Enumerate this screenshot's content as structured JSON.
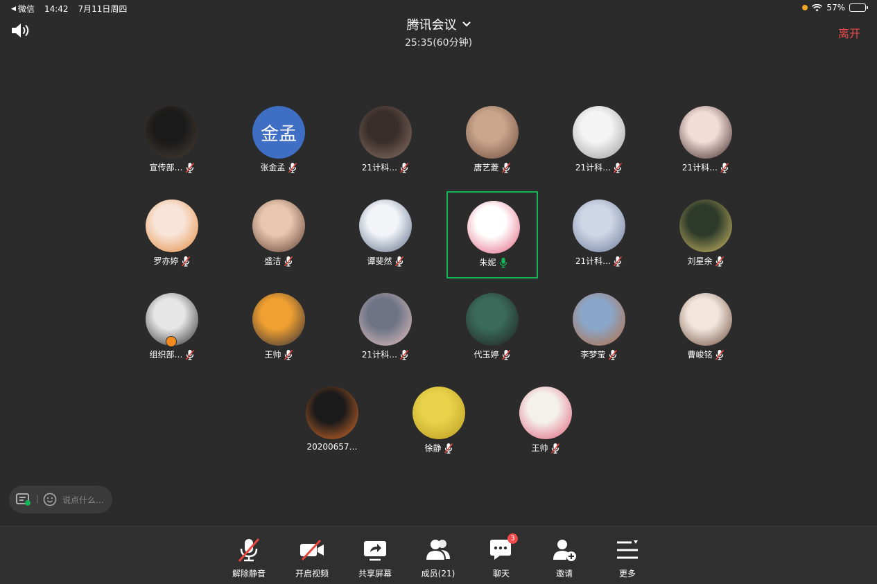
{
  "status_bar": {
    "back_app": "微信",
    "time": "14:42",
    "date": "7月11日周四",
    "battery": "57%",
    "battery_level": 0.57
  },
  "header": {
    "title": "腾讯会议",
    "timer": "25:35(60分钟)",
    "leave_label": "离开"
  },
  "participants": [
    {
      "name": "宣传部…",
      "muted": true,
      "avatar_colors": [
        "#1a1a1a",
        "#4a4038"
      ]
    },
    {
      "name": "张金孟",
      "muted": true,
      "avatar_text": "金孟",
      "avatar_colors": [
        "#3f6fc4",
        "#3f6fc4"
      ]
    },
    {
      "name": "21计科…",
      "muted": true,
      "avatar_colors": [
        "#3a2e2a",
        "#8c7468"
      ]
    },
    {
      "name": "唐艺菱",
      "muted": true,
      "avatar_colors": [
        "#c9a58c",
        "#6b4a3a"
      ]
    },
    {
      "name": "21计科…",
      "muted": true,
      "avatar_colors": [
        "#f4f4f4",
        "#999999"
      ]
    },
    {
      "name": "21计科…",
      "muted": true,
      "avatar_colors": [
        "#f2dcd6",
        "#3a2424"
      ]
    },
    {
      "name": "罗亦婷",
      "muted": true,
      "avatar_colors": [
        "#f8e4d8",
        "#e38a3a"
      ]
    },
    {
      "name": "盛洁",
      "muted": true,
      "avatar_colors": [
        "#e8c7b0",
        "#5c3a2e"
      ]
    },
    {
      "name": "谭斐然",
      "muted": true,
      "avatar_colors": [
        "#f2f4f8",
        "#5a6a86"
      ]
    },
    {
      "name": "朱妮",
      "muted": false,
      "speaking": true,
      "avatar_colors": [
        "#ffffff",
        "#e05a7a"
      ]
    },
    {
      "name": "21计科…",
      "muted": true,
      "avatar_colors": [
        "#cfd6e6",
        "#6b7a99"
      ]
    },
    {
      "name": "刘星余",
      "muted": true,
      "avatar_colors": [
        "#2d3a2a",
        "#d9c36a"
      ]
    },
    {
      "name": "组织部…",
      "muted": true,
      "host_badge": true,
      "avatar_colors": [
        "#e6e6e6",
        "#2a2a2a"
      ]
    },
    {
      "name": "王帅",
      "muted": true,
      "avatar_colors": [
        "#f0a030",
        "#2a2a3a"
      ]
    },
    {
      "name": "21计科…",
      "muted": true,
      "avatar_colors": [
        "#6e7486",
        "#e8c4c0"
      ]
    },
    {
      "name": "代玉婷",
      "muted": true,
      "avatar_colors": [
        "#3a6a5a",
        "#1e1e1e"
      ]
    },
    {
      "name": "李梦莹",
      "muted": true,
      "avatar_colors": [
        "#8aa6c8",
        "#b86a3a"
      ]
    },
    {
      "name": "曹峻铭",
      "muted": true,
      "avatar_colors": [
        "#f2e6dc",
        "#6a4a3a"
      ]
    },
    {
      "name": "20200657…",
      "muted": false,
      "avatar_colors": [
        "#1a1a1a",
        "#e0702a"
      ]
    },
    {
      "name": "徐静",
      "muted": true,
      "avatar_colors": [
        "#e8d24a",
        "#b89820"
      ]
    },
    {
      "name": "王帅",
      "muted": true,
      "avatar_colors": [
        "#f4f0ea",
        "#e05a78"
      ]
    }
  ],
  "chat_input": {
    "placeholder": "说点什么…"
  },
  "toolbar": {
    "items": [
      {
        "label": "解除静音",
        "icon": "muted-mic-icon"
      },
      {
        "label": "开启视频",
        "icon": "video-off-icon"
      },
      {
        "label": "共享屏幕",
        "icon": "share-screen-icon"
      },
      {
        "label": "成员(21)",
        "icon": "members-icon"
      },
      {
        "label": "聊天",
        "icon": "chat-icon",
        "badge": "3"
      },
      {
        "label": "邀请",
        "icon": "invite-icon"
      },
      {
        "label": "更多",
        "icon": "more-menu-icon"
      }
    ]
  },
  "colors": {
    "background": "#2b2b2b",
    "toolbar_bg": "#2f2f2f",
    "leave_red": "#f04a4a",
    "speaking_green": "#16b356",
    "mute_red": "#e8453c"
  }
}
